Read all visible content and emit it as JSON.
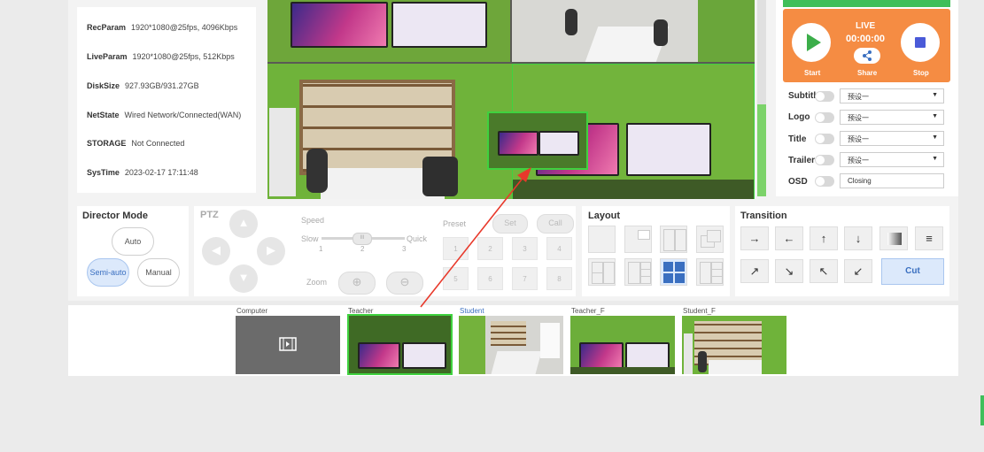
{
  "info": {
    "rows": [
      {
        "label": "RecParam",
        "value": "1920*1080@25fps, 4096Kbps"
      },
      {
        "label": "LiveParam",
        "value": "1920*1080@25fps, 512Kbps"
      },
      {
        "label": "DiskSize",
        "value": "927.93GB/931.27GB"
      },
      {
        "label": "NetState",
        "value": "Wired Network/Connected(WAN)"
      },
      {
        "label": "STORAGE",
        "value": "Not Connected"
      },
      {
        "label": "SysTime",
        "value": "2023-02-17 17:11:48"
      }
    ]
  },
  "live": {
    "title": "LIVE",
    "time": "00:00:00",
    "start_label": "Start",
    "share_label": "Share",
    "stop_label": "Stop"
  },
  "overlays": [
    {
      "label": "Subtitl",
      "value": "预设一"
    },
    {
      "label": "Logo",
      "value": "预设一"
    },
    {
      "label": "Title",
      "value": "预设一"
    },
    {
      "label": "Trailer",
      "value": "预设一"
    },
    {
      "label": "OSD",
      "value": "Closing"
    }
  ],
  "director": {
    "title": "Director Mode",
    "auto_label": "Auto",
    "semi_label": "Semi-auto",
    "manual_label": "Manual",
    "active": "Semi-auto"
  },
  "ptz": {
    "title": "PTZ",
    "speed_label": "Speed",
    "slow_label": "Slow",
    "quick_label": "Quick",
    "ticks": [
      "1",
      "2",
      "3"
    ],
    "zoom_label": "Zoom",
    "preset_label": "Preset",
    "set_label": "Set",
    "call_label": "Call",
    "presets": [
      "1",
      "2",
      "3",
      "4",
      "5",
      "6",
      "7",
      "8"
    ]
  },
  "layout": {
    "title": "Layout",
    "active_index": 6
  },
  "transition": {
    "title": "Transition",
    "cut_label": "Cut",
    "accent": "#3a6fc0"
  },
  "sources": [
    {
      "label": "Computer"
    },
    {
      "label": "Teacher"
    },
    {
      "label": "Student"
    },
    {
      "label": "Teacher_F"
    },
    {
      "label": "Student_F"
    }
  ],
  "colors": {
    "live_orange": "#f58c43",
    "select_green": "#3fd23f",
    "annotation_red": "#e8392b",
    "active_blue": "#3a6fc0"
  }
}
